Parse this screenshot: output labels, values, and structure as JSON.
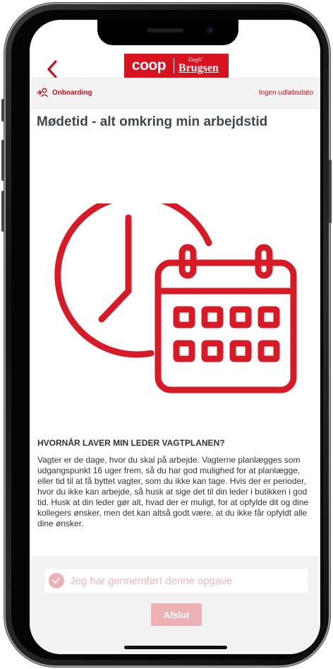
{
  "header": {
    "back_icon": "chevron-left-icon",
    "logo": {
      "coop": "coop",
      "dagli": "Dagli'",
      "brugsen": "Brugsen"
    }
  },
  "subbar": {
    "category_icon": "person-arrow-icon",
    "category": "Onboarding",
    "expiry": "Ingen udløbsdato"
  },
  "page": {
    "title": "Mødetid - alt omkring min arbejdstid",
    "hero_icon": "clock-calendar-icon",
    "section_heading": "HVORNÅR LAVER MIN LEDER VAGTPLANEN?",
    "body": "Vagter er de dage, hvor du skal på arbejde. Vagterne planlægges som udgangspunkt 16 uger frem, så du har god mulighed for at planlægge, eller tid til at få byttet vagter, som du ikke kan tage. Hvis der er perioder, hvor du ikke kan arbejde, så husk at sige det til din leder i butikken i god tid. Husk at din leder gør alt, hvad der er muligt, for at opfylde dit og dine kollegers ønsker, men det kan altså godt være, at du ikke får opfyldt alle dine ønsker."
  },
  "footer": {
    "checkbox_label": "Jeg har gennemført denne opgave",
    "checkbox_icon": "check-icon",
    "finish_label": "Afslut"
  },
  "colors": {
    "brand_red": "#d9121f",
    "disabled_pink": "#ecb1b4",
    "title_gray": "#3f4650"
  }
}
